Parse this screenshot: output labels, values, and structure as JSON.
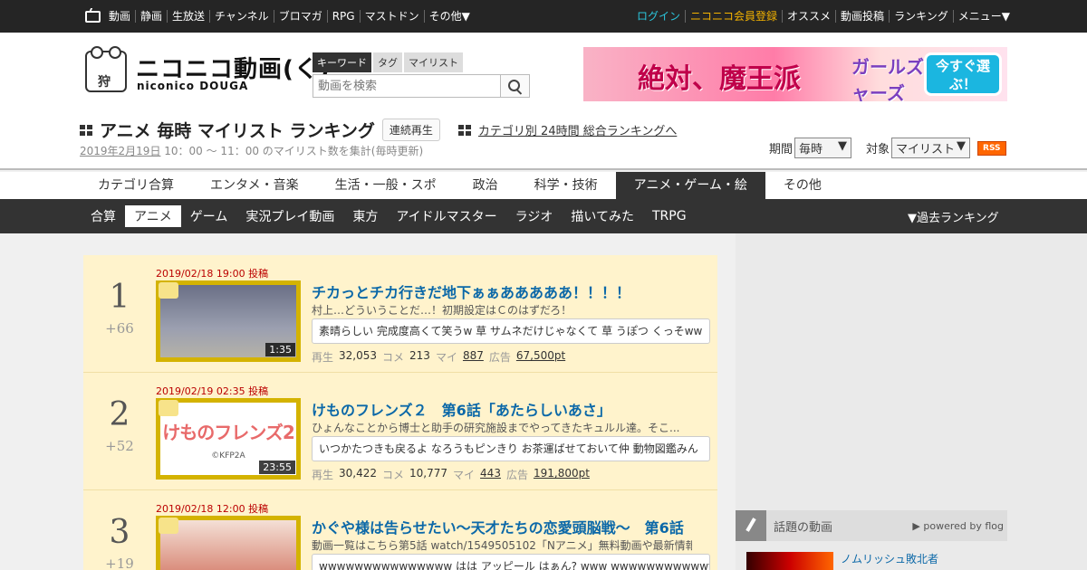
{
  "topnav": {
    "left": [
      "動画",
      "静画",
      "生放送",
      "チャンネル",
      "ブロマガ",
      "RPG",
      "マストドン",
      "その他▼"
    ],
    "right": [
      "ログイン",
      "ニコニコ会員登録",
      "オススメ",
      "動画投稿",
      "ランキング",
      "メニュー▼"
    ]
  },
  "logo": {
    "main": "ニコニコ動画(く)",
    "sub": "niconico DOUGA",
    "mark": "狩"
  },
  "search": {
    "tabs": [
      "キーワード",
      "タグ",
      "マイリスト"
    ],
    "placeholder": "動画を検索"
  },
  "banner": {
    "title": "絶対、魔王派",
    "brand": "ガールズクリーチャーズ",
    "cta": "今すぐ選ぶ！"
  },
  "ranking": {
    "title": "アニメ 毎時 マイリスト ランキング",
    "continuous": "連続再生",
    "category_link": "カテゴリ別 24時間 総合ランキングへ",
    "period_date": "2019年2月19日",
    "period_rest": " 10：00 ～ 11：00 のマイリスト数を集計(毎時更新)"
  },
  "controls": {
    "period_label": "期間",
    "period_value": "毎時",
    "target_label": "対象",
    "target_value": "マイリスト",
    "rss": "RSS"
  },
  "categories": [
    "カテゴリ合算",
    "エンタメ・音楽",
    "生活・一般・スポ",
    "政治",
    "科学・技術",
    "アニメ・ゲーム・絵",
    "その他"
  ],
  "subcategories": [
    "合算",
    "アニメ",
    "ゲーム",
    "実況プレイ動画",
    "東方",
    "アイドルマスター",
    "ラジオ",
    "描いてみた",
    "TRPG"
  ],
  "past_ranking": "▼過去ランキング",
  "items": [
    {
      "rank": "1",
      "diff": "+66",
      "date": "2019/02/18 19:00 投稿",
      "length": "1:35",
      "title": "チカっとチカ行きだ地下ぁぁあああああ！！！！",
      "desc": "村上…どういうことだ…！初期設定はＣのはずだろ！",
      "comment": "素晴らしい 完成度高くて笑うw 草 サムネだけじゃなくて 草 うぽつ くっそww",
      "views": "32,053",
      "comments": "213",
      "mylists": "887",
      "ad": "67,500pt"
    },
    {
      "rank": "2",
      "diff": "+52",
      "date": "2019/02/19 02:35 投稿",
      "length": "23:55",
      "title": "けものフレンズ２　第6話「あたらしいあさ」",
      "desc": "ひょんなことから博士と助手の研究施設までやってきたキュルル達。そこ...",
      "comment": "いつかたつきも戻るよ なろうもピンきり お茶運ばせておいて仲 動物図鑑みん",
      "views": "30,422",
      "comments": "10,777",
      "mylists": "443",
      "ad": "191,800pt",
      "thumb_logo": "けものフレンズ2",
      "thumb_credit": "©KFP2A"
    },
    {
      "rank": "3",
      "diff": "+19",
      "date": "2019/02/18 12:00 投稿",
      "title": "かぐや様は告らせたい～天才たちの恋愛頭脳戦～　第6話",
      "desc": "動画一覧はこちら第5話 watch/1549505102「Nアニメ」無料動画や最新情報...",
      "comment": "wwwwwwwwwwwwwww はは アッピール はぁん? www wwwwwwwwwwwww"
    }
  ],
  "stat_labels": {
    "views": "再生",
    "comments": "コメ",
    "mylists": "マイ",
    "ad": "広告"
  },
  "side": {
    "topic_title": "話題の動画",
    "powered": "▶ powered by flog",
    "topic_item": "ノムリッシュ敗北者"
  },
  "colors": {
    "accent_link": "#0b68a8",
    "login": "#2bc6dc",
    "register": "#f3b200",
    "rank_bg": "#fff3cc",
    "date_red": "#bb0000"
  }
}
